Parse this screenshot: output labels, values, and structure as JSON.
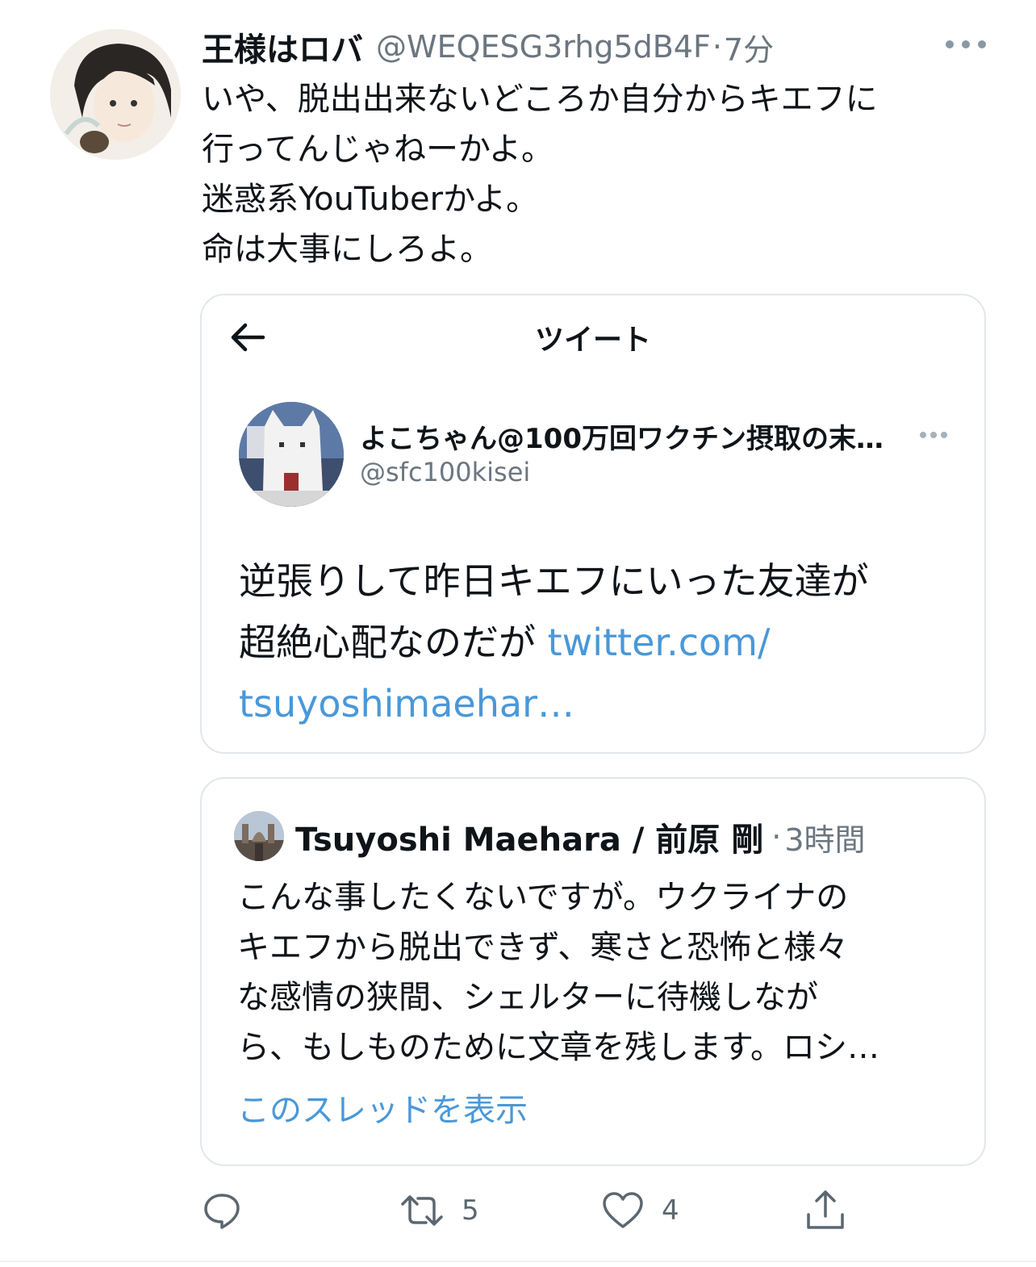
{
  "tweet": {
    "display_name": "王様はロバ",
    "handle": "@WEQESG3rhg5dB4F",
    "separator": "·",
    "time": "7分",
    "lines": [
      "いや、脱出出来ないどころか自分からキエフに",
      "行ってんじゃねーかよ。",
      "迷惑系YouTuberかよ。",
      "命は大事にしろよ。"
    ]
  },
  "quote1": {
    "header_title": "ツイート",
    "display_name": "よこちゃん@100万回ワクチン摂取の末…",
    "handle": "@sfc100kisei",
    "text_line1": "逆張りして昨日キエフにいった友達が",
    "text_line2": "超絶心配なのだが",
    "link_part1": "twitter.com/",
    "link_part2": "tsuyoshimaehar…"
  },
  "quote2": {
    "display_name": "Tsuyoshi Maehara / 前原 剛",
    "separator": "·",
    "time": "3時間",
    "lines": [
      "こんな事したくないですが。ウクライナの",
      "キエフから脱出できず、寒さと恐怖と様々",
      "な感情の狭間、シェルターに待機しなが",
      "ら、もしものために文章を残します。ロシ…"
    ],
    "show_thread": "このスレッドを表示"
  },
  "actions": {
    "retweet_count": "5",
    "like_count": "4"
  },
  "colors": {
    "link": "#4a98d8",
    "secondary_text": "#6b7680",
    "card_border": "#e3e7ea"
  }
}
